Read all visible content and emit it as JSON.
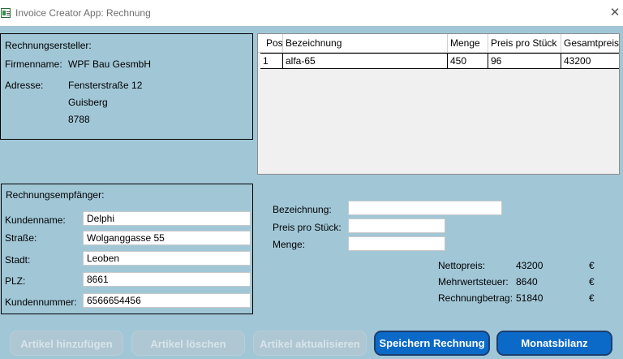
{
  "window": {
    "title": "Invoice Creator App: Rechnung",
    "close_glyph": "✕"
  },
  "creator": {
    "heading": "Rechnungsersteller:",
    "company_label": "Firmenname:",
    "company_value": "WPF Bau GesmbH",
    "address_label": "Adresse:",
    "street": "Fensterstraße 12",
    "city": "Guisberg",
    "zip": "8788"
  },
  "items_table": {
    "columns": [
      "Pos",
      "Bezeichnung",
      "Menge",
      "Preis pro Stück",
      "Gesamtpreis"
    ],
    "rows": [
      {
        "pos": "1",
        "bezeichnung": "alfa-65",
        "menge": "450",
        "preis": "96",
        "gesamt": "43200"
      }
    ]
  },
  "recipient": {
    "heading": "Rechnungsempfänger:",
    "customer_name_label": "Kundenname:",
    "customer_name_value": "Delphi",
    "street_label": "Straße:",
    "street_value": "Wolganggasse 55",
    "city_label": "Stadt:",
    "city_value": "Leoben",
    "zip_label": "PLZ:",
    "zip_value": "8661",
    "customer_number_label": "Kundennummer:",
    "customer_number_value": "6566654456"
  },
  "item_form": {
    "description_label": "Bezeichnung:",
    "description_value": "",
    "unit_price_label": "Preis pro Stück:",
    "unit_price_value": "",
    "quantity_label": "Menge:",
    "quantity_value": ""
  },
  "totals": {
    "net_label": "Nettopreis:",
    "net_value": "43200",
    "vat_label": "Mehrwertsteuer:",
    "vat_value": "8640",
    "total_label": "Rechnungbetrag:",
    "total_value": "51840",
    "currency": "€"
  },
  "buttons": {
    "add_item": "Artikel hinzufügen",
    "delete_item": "Artikel löschen",
    "update_item": "Artikel aktualisieren",
    "save_invoice": "Speichern Rechnung",
    "monthly_balance": "Monatsbilanz"
  },
  "colors": {
    "background": "#a1c7d7",
    "primary_button": "#0b6ac8",
    "disabled_button": "#aec7d2"
  }
}
